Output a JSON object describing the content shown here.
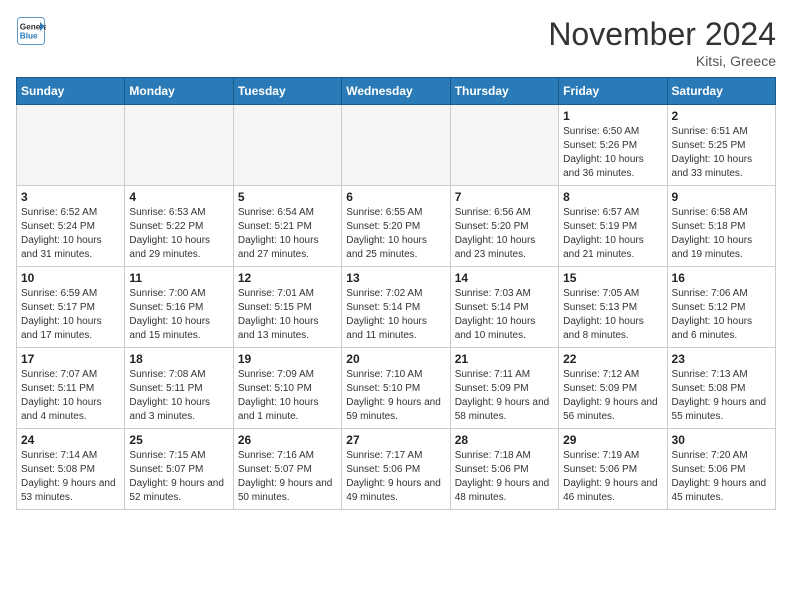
{
  "header": {
    "logo_general": "General",
    "logo_blue": "Blue",
    "month_title": "November 2024",
    "location": "Kitsi, Greece"
  },
  "days_of_week": [
    "Sunday",
    "Monday",
    "Tuesday",
    "Wednesday",
    "Thursday",
    "Friday",
    "Saturday"
  ],
  "weeks": [
    [
      {
        "day": "",
        "info": ""
      },
      {
        "day": "",
        "info": ""
      },
      {
        "day": "",
        "info": ""
      },
      {
        "day": "",
        "info": ""
      },
      {
        "day": "",
        "info": ""
      },
      {
        "day": "1",
        "info": "Sunrise: 6:50 AM\nSunset: 5:26 PM\nDaylight: 10 hours and 36 minutes."
      },
      {
        "day": "2",
        "info": "Sunrise: 6:51 AM\nSunset: 5:25 PM\nDaylight: 10 hours and 33 minutes."
      }
    ],
    [
      {
        "day": "3",
        "info": "Sunrise: 6:52 AM\nSunset: 5:24 PM\nDaylight: 10 hours and 31 minutes."
      },
      {
        "day": "4",
        "info": "Sunrise: 6:53 AM\nSunset: 5:22 PM\nDaylight: 10 hours and 29 minutes."
      },
      {
        "day": "5",
        "info": "Sunrise: 6:54 AM\nSunset: 5:21 PM\nDaylight: 10 hours and 27 minutes."
      },
      {
        "day": "6",
        "info": "Sunrise: 6:55 AM\nSunset: 5:20 PM\nDaylight: 10 hours and 25 minutes."
      },
      {
        "day": "7",
        "info": "Sunrise: 6:56 AM\nSunset: 5:20 PM\nDaylight: 10 hours and 23 minutes."
      },
      {
        "day": "8",
        "info": "Sunrise: 6:57 AM\nSunset: 5:19 PM\nDaylight: 10 hours and 21 minutes."
      },
      {
        "day": "9",
        "info": "Sunrise: 6:58 AM\nSunset: 5:18 PM\nDaylight: 10 hours and 19 minutes."
      }
    ],
    [
      {
        "day": "10",
        "info": "Sunrise: 6:59 AM\nSunset: 5:17 PM\nDaylight: 10 hours and 17 minutes."
      },
      {
        "day": "11",
        "info": "Sunrise: 7:00 AM\nSunset: 5:16 PM\nDaylight: 10 hours and 15 minutes."
      },
      {
        "day": "12",
        "info": "Sunrise: 7:01 AM\nSunset: 5:15 PM\nDaylight: 10 hours and 13 minutes."
      },
      {
        "day": "13",
        "info": "Sunrise: 7:02 AM\nSunset: 5:14 PM\nDaylight: 10 hours and 11 minutes."
      },
      {
        "day": "14",
        "info": "Sunrise: 7:03 AM\nSunset: 5:14 PM\nDaylight: 10 hours and 10 minutes."
      },
      {
        "day": "15",
        "info": "Sunrise: 7:05 AM\nSunset: 5:13 PM\nDaylight: 10 hours and 8 minutes."
      },
      {
        "day": "16",
        "info": "Sunrise: 7:06 AM\nSunset: 5:12 PM\nDaylight: 10 hours and 6 minutes."
      }
    ],
    [
      {
        "day": "17",
        "info": "Sunrise: 7:07 AM\nSunset: 5:11 PM\nDaylight: 10 hours and 4 minutes."
      },
      {
        "day": "18",
        "info": "Sunrise: 7:08 AM\nSunset: 5:11 PM\nDaylight: 10 hours and 3 minutes."
      },
      {
        "day": "19",
        "info": "Sunrise: 7:09 AM\nSunset: 5:10 PM\nDaylight: 10 hours and 1 minute."
      },
      {
        "day": "20",
        "info": "Sunrise: 7:10 AM\nSunset: 5:10 PM\nDaylight: 9 hours and 59 minutes."
      },
      {
        "day": "21",
        "info": "Sunrise: 7:11 AM\nSunset: 5:09 PM\nDaylight: 9 hours and 58 minutes."
      },
      {
        "day": "22",
        "info": "Sunrise: 7:12 AM\nSunset: 5:09 PM\nDaylight: 9 hours and 56 minutes."
      },
      {
        "day": "23",
        "info": "Sunrise: 7:13 AM\nSunset: 5:08 PM\nDaylight: 9 hours and 55 minutes."
      }
    ],
    [
      {
        "day": "24",
        "info": "Sunrise: 7:14 AM\nSunset: 5:08 PM\nDaylight: 9 hours and 53 minutes."
      },
      {
        "day": "25",
        "info": "Sunrise: 7:15 AM\nSunset: 5:07 PM\nDaylight: 9 hours and 52 minutes."
      },
      {
        "day": "26",
        "info": "Sunrise: 7:16 AM\nSunset: 5:07 PM\nDaylight: 9 hours and 50 minutes."
      },
      {
        "day": "27",
        "info": "Sunrise: 7:17 AM\nSunset: 5:06 PM\nDaylight: 9 hours and 49 minutes."
      },
      {
        "day": "28",
        "info": "Sunrise: 7:18 AM\nSunset: 5:06 PM\nDaylight: 9 hours and 48 minutes."
      },
      {
        "day": "29",
        "info": "Sunrise: 7:19 AM\nSunset: 5:06 PM\nDaylight: 9 hours and 46 minutes."
      },
      {
        "day": "30",
        "info": "Sunrise: 7:20 AM\nSunset: 5:06 PM\nDaylight: 9 hours and 45 minutes."
      }
    ]
  ]
}
